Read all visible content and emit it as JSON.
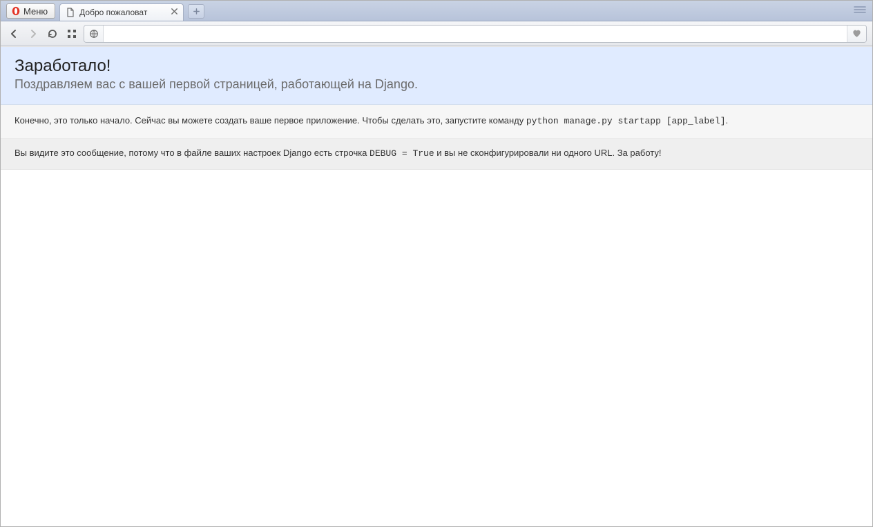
{
  "chrome": {
    "menu_label": "Меню",
    "active_tab_title": "Добро пожаловат",
    "address_value": ""
  },
  "page": {
    "heading": "Заработало!",
    "subheading": "Поздравляем вас с вашей первой страницей, работающей на Django.",
    "instructions_pre": "Конечно, это только начало. Сейчас вы можете создать ваше первое приложение. Чтобы сделать это, запустите команду ",
    "instructions_cmd": "python manage.py startapp [app_label]",
    "instructions_post": ".",
    "explanation_pre": "Вы видите это сообщение, потому что в файле ваших настроек Django есть строчка ",
    "explanation_code": "DEBUG = True",
    "explanation_post": " и вы не сконфигурировали ни одного URL. За работу!"
  }
}
